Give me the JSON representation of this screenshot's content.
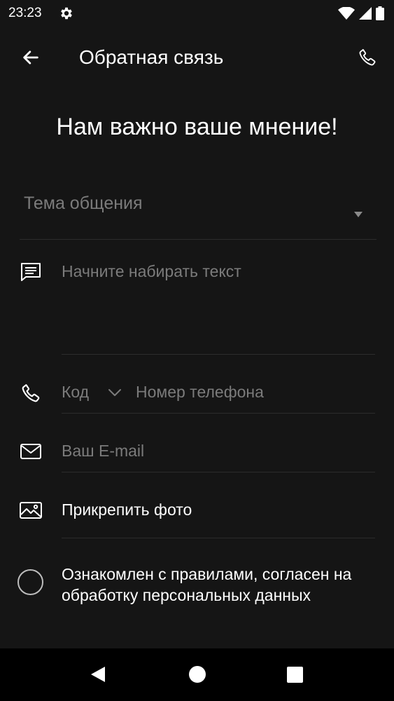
{
  "status_bar": {
    "time": "23:23"
  },
  "app_bar": {
    "title": "Обратная связь"
  },
  "headline": "Нам важно ваше мнение!",
  "form": {
    "topic_placeholder": "Тема общения",
    "message_placeholder": "Начните набирать текст",
    "phone_code_placeholder": "Код",
    "phone_placeholder": "Номер телефона",
    "email_placeholder": "Ваш E-mail",
    "attach_label": "Прикрепить фото",
    "consent_text": "Ознакомлен с правилами, согласен на обработку персональных данных"
  },
  "colors": {
    "background": "#151515",
    "placeholder": "#7b7b7b",
    "divider": "#2c2c2c",
    "text": "#ffffff"
  },
  "icons": {
    "status": [
      "gear-icon",
      "wifi-icon",
      "cell-signal-icon",
      "battery-icon"
    ],
    "app_bar": [
      "back-arrow-icon",
      "phone-call-icon"
    ],
    "form": [
      "chat-icon",
      "phone-icon",
      "chevron-down-icon",
      "mail-icon",
      "image-icon"
    ],
    "nav": [
      "nav-back-icon",
      "nav-home-icon",
      "nav-recents-icon"
    ]
  }
}
